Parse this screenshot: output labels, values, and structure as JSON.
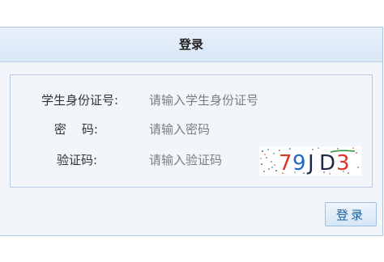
{
  "header": {
    "title": "登录"
  },
  "form": {
    "student_id": {
      "label": "学生身份证号:",
      "placeholder": "请输入学生身份证号"
    },
    "password": {
      "label": "密    码:",
      "placeholder": "请输入密码"
    },
    "captcha": {
      "label": "验证码:",
      "placeholder": "请输入验证码",
      "code": "79JD3"
    }
  },
  "actions": {
    "login_label": "登录"
  }
}
